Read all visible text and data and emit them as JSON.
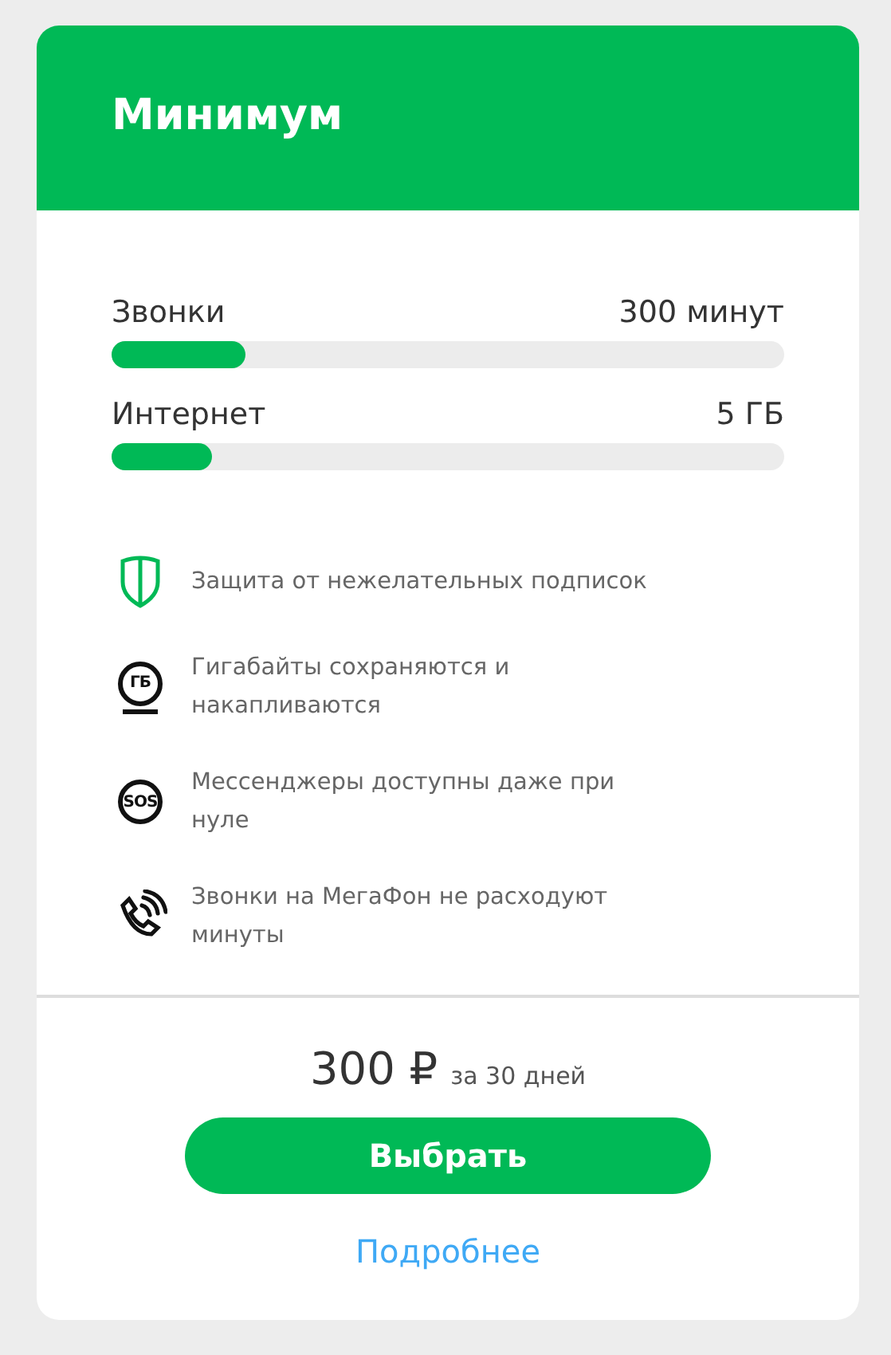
{
  "title": "Минимум",
  "allowances": [
    {
      "label": "Звонки",
      "value": "300 минут",
      "level": 0.2
    },
    {
      "label": "Интернет",
      "value": "5 ГБ",
      "level": 0.15
    }
  ],
  "features": [
    {
      "kind": "shield",
      "text": "Защита от нежелательных подписок"
    },
    {
      "kind": "badge",
      "badge": "ГБ",
      "underline": true,
      "text": "Гигабайты сохраняются и накапливаются"
    },
    {
      "kind": "badge",
      "badge": "SOS",
      "underline": false,
      "text": "Мессенджеры доступны даже при нуле"
    },
    {
      "kind": "phone",
      "text": "Звонки на МегаФон не расходуют минуты"
    }
  ],
  "price": {
    "amount": "300 ₽",
    "period": "за 30 дней"
  },
  "button": "Выбрать",
  "link": "Подробнее"
}
